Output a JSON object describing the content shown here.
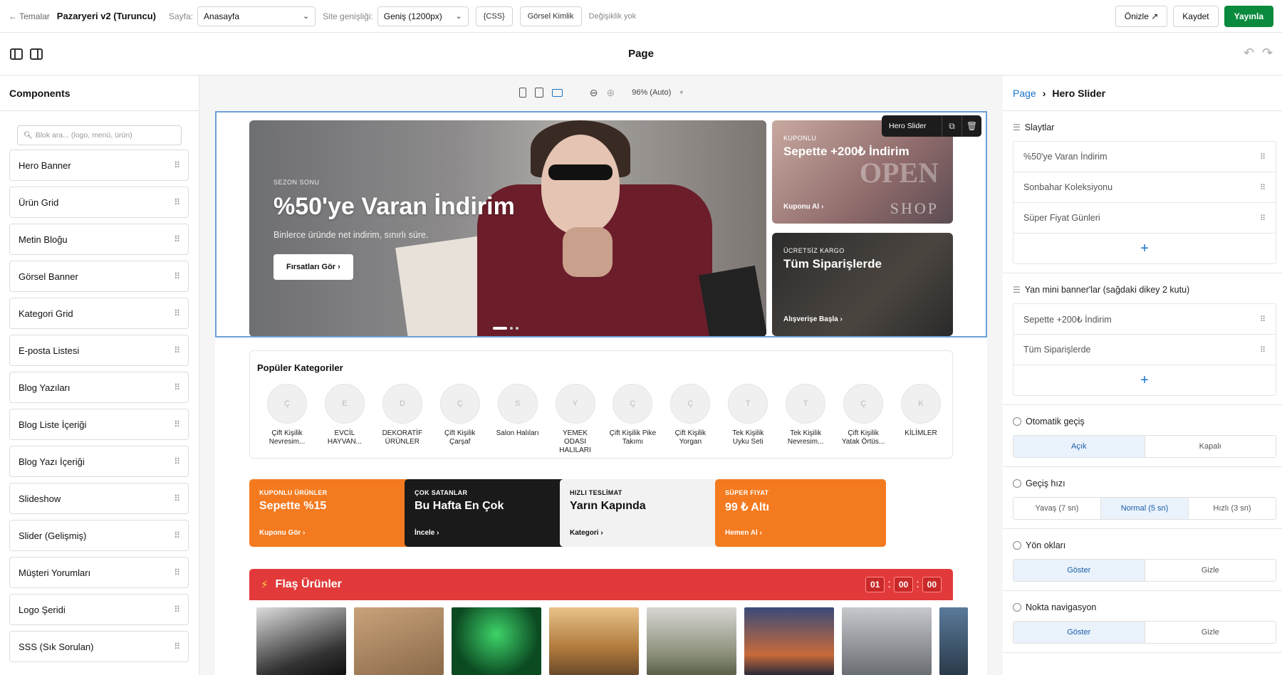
{
  "topbar": {
    "back": "← Temalar",
    "theme": "Pazaryeri v2 (Turuncu)",
    "page_label": "Sayfa:",
    "page_value": "Anasayfa",
    "width_label": "Site genişliği:",
    "width_value": "Geniş (1200px)",
    "css_btn": "{CSS}",
    "visual_btn": "Görsel Kimlik",
    "status": "Değişiklik yok",
    "preview": "Önizle ↗",
    "save": "Kaydet",
    "publish": "Yayınla",
    "colors": {
      "publish": "#0a8a3d",
      "accent": "#1a73c9"
    }
  },
  "header": {
    "title": "Page",
    "undo_icon": "undo-icon",
    "redo_icon": "redo-icon"
  },
  "components": {
    "title": "Components",
    "search_placeholder": "Blok ara... (logo, menü, ürün)",
    "items": [
      "Hero Banner",
      "Ürün Grid",
      "Metin Bloğu",
      "Görsel Banner",
      "Kategori Grid",
      "E-posta Listesi",
      "Blog Yazıları",
      "Blog Liste İçeriği",
      "Blog Yazı İçeriği",
      "Slideshow",
      "Slider (Gelişmiş)",
      "Müşteri Yorumları",
      "Logo Şeridi",
      "SSS (Sık Sorulan)"
    ]
  },
  "canvas": {
    "zoom": "96% (Auto)",
    "hero_toolbar": "Hero Slider",
    "hero": {
      "kicker": "SEZON SONU",
      "title": "%50'ye Varan İndirim",
      "subtitle": "Binlerce üründe net indirim, sınırlı süre.",
      "cta": "Fırsatları Gör  ›"
    },
    "mini1": {
      "kicker": "KUPONLU",
      "title": "Sepette +200₺ İndirim",
      "link": "Kuponu Al  ›",
      "deco1": "OPEN",
      "deco2": "SHOP"
    },
    "mini2": {
      "kicker": "ÜCRETSİZ KARGO",
      "title": "Tüm Siparişlerde",
      "link": "Alışverişe Başla  ›"
    },
    "categories": {
      "title": "Popüler Kategoriler",
      "items": [
        {
          "initial": "Ç",
          "name": "Çift Kişilik Nevresim..."
        },
        {
          "initial": "E",
          "name": "EVCİL HAYVAN..."
        },
        {
          "initial": "D",
          "name": "DEKORATİF ÜRÜNLER"
        },
        {
          "initial": "Ç",
          "name": "Çift Kişilik Çarşaf"
        },
        {
          "initial": "S",
          "name": "Salon Halıları"
        },
        {
          "initial": "Y",
          "name": "YEMEK ODASI HALILARI"
        },
        {
          "initial": "Ç",
          "name": "Çift Kişilik Pike Takımı"
        },
        {
          "initial": "Ç",
          "name": "Çift Kişilik Yorgan"
        },
        {
          "initial": "T",
          "name": "Tek Kişilik Uyku Seti"
        },
        {
          "initial": "T",
          "name": "Tek Kişilik Nevresim..."
        },
        {
          "initial": "Ç",
          "name": "Çift Kişilik Yatak Örtüs..."
        },
        {
          "initial": "K",
          "name": "KİLİMLER"
        }
      ]
    },
    "promos": [
      {
        "kicker": "KUPONLU ÜRÜNLER",
        "title": "Sepette %15",
        "link": "Kuponu Gör ›",
        "style": "orange"
      },
      {
        "kicker": "ÇOK SATANLAR",
        "title": "Bu Hafta En Çok",
        "link": "İncele ›",
        "style": "black"
      },
      {
        "kicker": "HIZLI TESLİMAT",
        "title": "Yarın Kapında",
        "link": "Kategori ›",
        "style": "gray"
      },
      {
        "kicker": "SÜPER FIYAT",
        "title": "99 ₺ Altı",
        "link": "Hemen Al ›",
        "style": "orange"
      }
    ],
    "flash": {
      "title": "Flaş Ürünler",
      "h": "01",
      "m": "00",
      "s": "00",
      "colon": ":"
    }
  },
  "inspector": {
    "crumb": "Page",
    "current": "Hero Slider",
    "slides_title": "Slaytlar",
    "slides": [
      "%50'ye Varan İndirim",
      "Sonbahar Koleksiyonu",
      "Süper Fiyat Günleri"
    ],
    "mini_title": "Yan mini banner'lar (sağdaki dikey 2 kutu)",
    "minis": [
      "Sepette +200₺ İndirim",
      "Tüm Siparişlerde"
    ],
    "auto_title": "Otomatik geçiş",
    "auto_on": "Açık",
    "auto_off": "Kapalı",
    "speed_title": "Geçiş hızı",
    "speed_slow": "Yavaş (7 sn)",
    "speed_normal": "Normal (5 sn)",
    "speed_fast": "Hızlı (3 sn)",
    "arrows_title": "Yön okları",
    "dots_title": "Nokta navigasyon",
    "show": "Göster",
    "hide": "Gizle"
  }
}
